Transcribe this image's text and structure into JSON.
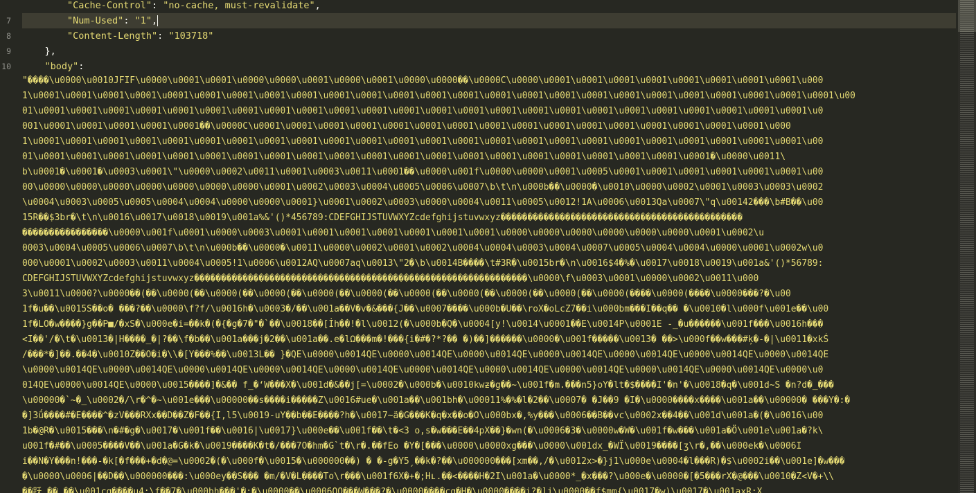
{
  "editor": {
    "current_line": 7,
    "line_numbers": [
      "",
      "7",
      "8",
      "9",
      "10"
    ],
    "lines": {
      "l6_key": "\"Cache-Control\"",
      "l6_sep": ": ",
      "l6_val": "\"no-cache, must-revalidate\"",
      "l6_end": ",",
      "l7_key": "\"Num-Used\"",
      "l7_sep": ": ",
      "l7_val": "\"1\"",
      "l7_end": ",",
      "l8_key": "\"Content-Length\"",
      "l8_sep": ": ",
      "l8_val": "\"103718\"",
      "l9": "},",
      "l10_key": "\"body\"",
      "l10_sep": ":"
    },
    "body_wrapped": [
      "\"����\\u0000\\u0010JFIF\\u0000\\u0001\\u0001\\u0000\\u0000\\u0001\\u0000\\u0001\\u0000\\u0000��\\u0000C\\u0000\\u0001\\u0001\\u0001\\u0001\\u0001\\u0001\\u0001\\u0001\\u000",
      "1\\u0001\\u0001\\u0001\\u0001\\u0001\\u0001\\u0001\\u0001\\u0001\\u0001\\u0001\\u0001\\u0001\\u0001\\u0001\\u0001\\u0001\\u0001\\u0001\\u0001\\u0001\\u0001\\u0001\\u0001\\u0001\\u00",
      "01\\u0001\\u0001\\u0001\\u0001\\u0001\\u0001\\u0001\\u0001\\u0001\\u0001\\u0001\\u0001\\u0001\\u0001\\u0001\\u0001\\u0001\\u0001\\u0001\\u0001\\u0001\\u0001\\u0001\\u0001\\u0",
      "001\\u0001\\u0001\\u0001\\u0001\\u0001��\\u0000C\\u0001\\u0001\\u0001\\u0001\\u0001\\u0001\\u0001\\u0001\\u0001\\u0001\\u0001\\u0001\\u0001\\u0001\\u0001\\u0001\\u000",
      "1\\u0001\\u0001\\u0001\\u0001\\u0001\\u0001\\u0001\\u0001\\u0001\\u0001\\u0001\\u0001\\u0001\\u0001\\u0001\\u0001\\u0001\\u0001\\u0001\\u0001\\u0001\\u0001\\u0001\\u0001\\u00",
      "01\\u0001\\u0001\\u0001\\u0001\\u0001\\u0001\\u0001\\u0001\\u0001\\u0001\\u0001\\u0001\\u0001\\u0001\\u0001\\u0001\\u0001\\u0001\\u0001\\u0001\\u0001�\\u0000\\u0011\\",
      "b\\u0001�\\u0001�\\u0003\\u0001\\\"\\u0000\\u0002\\u0011\\u0001\\u0003\\u0011\\u0001��\\u0000\\u001f\\u0000\\u0000\\u0001\\u0005\\u0001\\u0001\\u0001\\u0001\\u0001\\u0001\\u00",
      "00\\u0000\\u0000\\u0000\\u0000\\u0000\\u0000\\u0000\\u0001\\u0002\\u0003\\u0004\\u0005\\u0006\\u0007\\b\\t\\n\\u000b��\\u0000�\\u0010\\u0000\\u0002\\u0001\\u0003\\u0003\\u0002",
      "\\u0004\\u0003\\u0005\\u0005\\u0004\\u0004\\u0000\\u0000\\u0001}\\u0001\\u0002\\u0003\\u0000\\u0004\\u0011\\u0005\\u0012!1A\\u0006\\u0013Qa\\u0007\\\"q\\u00142���\\b#B��\\u00",
      "15R��$3br�\\t\\n\\u0016\\u0017\\u0018\\u0019\\u001a%&'()*456789:CDEFGHIJSTUVWXYZcdefghijstuvwxyz���������������������������������������������",
      "����������������\\u0000\\u001f\\u0001\\u0000\\u0003\\u0001\\u0001\\u0001\\u0001\\u0001\\u0001\\u0001\\u0000\\u0000\\u0000\\u0000\\u0000\\u0000\\u0001\\u0002\\u",
      "0003\\u0004\\u0005\\u0006\\u0007\\b\\t\\n\\u000b��\\u0000�\\u0011\\u0000\\u0002\\u0001\\u0002\\u0004\\u0004\\u0003\\u0004\\u0007\\u0005\\u0004\\u0004\\u0000\\u0001\\u0002w\\u0",
      "000\\u0001\\u0002\\u0003\\u0011\\u0004\\u0005!1\\u0006\\u0012AQ\\u0007aq\\u0013\\\"2�\\b\\u0014B����\\t#3R�\\u0015br�\\n\\u0016$4�%�\\u0017\\u0018\\u0019\\u001a&'()*56789:",
      "CDEFGHIJSTUVWXYZcdefghijstuvwxyz��������������������������������������������������������������\\u0000\\f\\u0003\\u0001\\u0000\\u0002\\u0011\\u000",
      "3\\u0011\\u0000?\\u0000��(��\\u0000(��\\u0000(��\\u0000(��\\u0000(��\\u0000(��\\u0000(��\\u0000(��\\u0000(��\\u0000(��\\u0000(����\\u0000(����\\u0000���?�\\u00",
      "1f�u��\\u0015S��o� ���?��\\u0000\\f?f/\\u0016h�\\u0003�/��\\u001a��V�v�&���{J��\\u0007����\\u000b�U��\\roX�oLcZ7��i\\u000bm���I��q�� �\\u0010�l\\u000f\\u001e��\\u00",
      "1f�LO�w����}g��P■/�xS�\\u000e�i=��k�(�{�g�7�\"�`��\\u0018��[İh��!�l\\u0012(�\\u000b�Q�\\u0004[y!\\u0014\\u0001��E\\u0014P\\u0001E -_�u������\\u001f���\\u0016h���",
      "<I��'/�\\t�\\u0013�|H����_�|?��\\f�b��\\u001a���j�2��\\u001a��.e�lΩ���m�!���{i�#�?*?�� �)��]������\\u0000�\\u001f�����\\u0013� ��>\\u000f��w���#ķ�-�|\\u0011�xkŚ",
      "/���*�]��.��4�\\u0010Z��O�i�\\\\�[Y���%��\\u0013L�� }�QE\\u0000\\u0014QE\\u0000\\u0014QE\\u0000\\u0014QE\\u0000\\u0014QE\\u0000\\u0014QE\\u0000\\u0014QE\\u0000\\u0014QE",
      "\\u0000\\u0014QE\\u0000\\u0014QE\\u0000\\u0014QE\\u0000\\u0014QE\\u0000\\u0014QE\\u0000\\u0014QE\\u0000\\u0014QE\\u0000\\u0014QE\\u0000\\u0014QE\\u0000\\u0014QE\\u0000\\u0",
      "014QE\\u0000\\u0014QE\\u0000\\u0015����]�&�� f_�‘W���X�\\u001d�&��j[=\\u0002�\\u000b�\\u0010kwƶ�g��~\\u001f�m.���n5}oY�lt�$����I'�n'�\\u0018�q�\\u001d~S �n?d�_���",
      "\\u00000�`~�_\\u0002�/\\r�^�~\\u001e���\\u00000��s����i�����Z\\u0016#ue�\\u001a��\\u001bh�\\u00011%�%�l�2��\\u0007� �J��9 �I�\\u0000����x����\\u001a��\\u00000� ���Y�:�",
      "�]3ǘ����#�E����^�zV���RXx��D��Z�F��{I,l5\\u0019-uY��b��E����?h�\\u0017~ä�G���K�q�x��o�O\\u000bx�,%y���\\u0006��B��vc\\u0002x��4��\\u001d\\u001a�(�\\u0016\\u00",
      "1b�@R�\\u0015���\\n�#�g�\\u0017�\\u001f��\\u0016|\\u0017}\\u000e��\\u001f��\\t�<3 o,s�w���E��4pX��}�wn(�\\u0006�3�\\u0000w�W�\\u001f�w���\\u001a�Ö\\u001e\\u001a�?k\\",
      "u001f�#��\\u0005����V��\\u001a�G�k�\\u0019����K�t�/���7O�hm�G`t�\\r�.��fEo �Y�[���\\u0000\\u0000xg���\\u0000\\u001dx_�WÏ\\u0019����[ʒ\\r�,��\\u000ek�\\u0006I",
      "i��N�Y���n!���-�k[�f���+�d�@=\\u0002�(�\\u000f�\\u0015�\\u000000��) � �-g�Y5ˏ��k�?��\\u000000���[xm��,/�\\u0012x>�}j1\\u000e\\u0004�l���R)�$\\u0002i��\\u001e]�w���",
      "�\\u0000\\u0006|��D��\\u000000���:\\u000ey��S��� �m/�V�L����To\\r���\\u001f6X�+�;Hʟ.��<����H�2I\\u001a�\\u0000*_�x���?\\u000e�\\u0000�[�5���rX�@���\\u0010�Z<V�+\\\\",
      "��跃 ��.��\\u001cq����u4:\\f��7�\\u000bh���'�:�\\u0000��\\u0006QQ���W���?�\\u0000����cq�H�\\u0000����i?�]j\\u0000��f$mm{\\u0017�w)\\u0017�\\u001axR;X"
    ]
  }
}
